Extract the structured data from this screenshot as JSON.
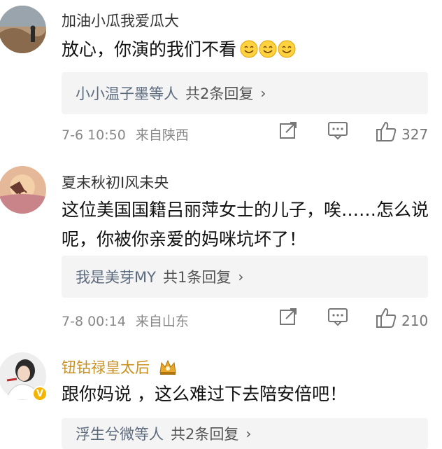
{
  "comments": [
    {
      "username": "加油小瓜我爱瓜大",
      "text": "放心，你演的我们不看",
      "emoji_count": 3,
      "reply_names": "小小温子墨等人",
      "reply_count": "共2条回复",
      "time": "7-6 10:50",
      "location": "来自陕西",
      "likes": "327"
    },
    {
      "username": "夏末秋初I风未央",
      "text": "这位美国国籍吕丽萍女士的儿子，唉……怎么说呢，你被你亲爱的妈咪坑坏了！",
      "reply_names": "我是美芽MY",
      "reply_count": "共1条回复",
      "time": "7-8 00:14",
      "location": "来自山东",
      "likes": "210"
    },
    {
      "username": "钮钴禄皇太后",
      "text": "跟你妈说 ，这么难过下去陪安倍吧！",
      "reply_names": "浮生兮微等人",
      "reply_count": "共2条回复"
    }
  ],
  "icons": {
    "share": "share-icon",
    "comment": "comment-icon",
    "like": "thumbs-up-icon",
    "chevron": "chevron-right-icon",
    "emoji": "smile-emoji-icon",
    "vip": "crown-badge-icon"
  },
  "colors": {
    "gold_name": "#c9901f",
    "reply_bg": "#f4f4f4",
    "reply_name": "#5d6b7e",
    "meta": "#888888"
  }
}
